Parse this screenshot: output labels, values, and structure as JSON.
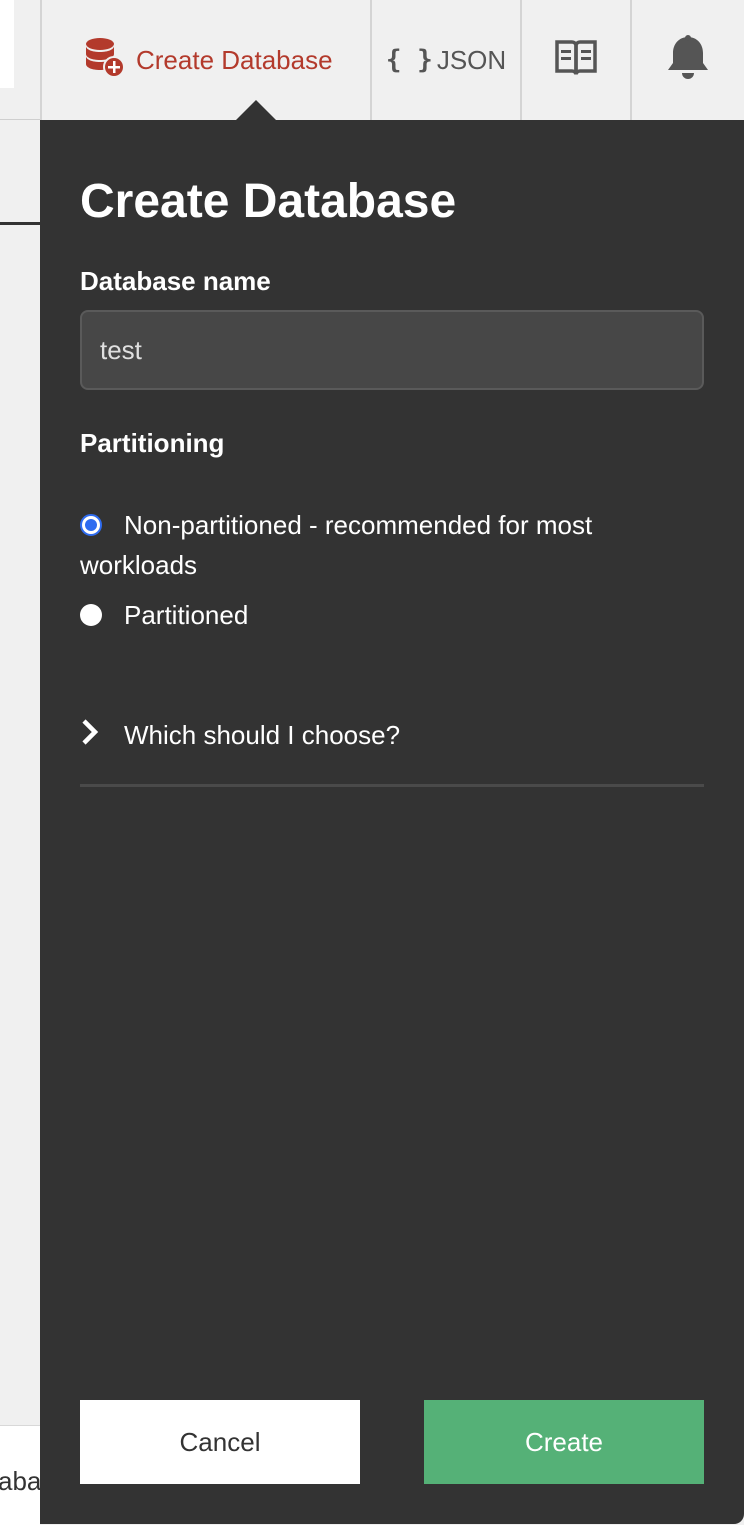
{
  "background": {
    "bottom_text": "aba"
  },
  "toolbar": {
    "create_database_label": "Create Database",
    "json_braces": "{ }",
    "json_label": "JSON"
  },
  "panel": {
    "title": "Create Database",
    "database_name_label": "Database name",
    "database_name_value": "test",
    "partitioning_label": "Partitioning",
    "options": [
      {
        "label": "Non-partitioned - recommended for most workloads",
        "selected": true
      },
      {
        "label": "Partitioned",
        "selected": false
      }
    ],
    "help_toggle": "Which should I choose?",
    "cancel_label": "Cancel",
    "create_label": "Create"
  },
  "colors": {
    "panel_bg": "#333333",
    "accent_red": "#b33a2c",
    "create_green": "#55b177",
    "radio_blue": "#2f6cf0"
  },
  "icons": [
    "database-add-icon",
    "json-braces-icon",
    "book-icon",
    "bell-icon",
    "chevron-right-icon"
  ]
}
